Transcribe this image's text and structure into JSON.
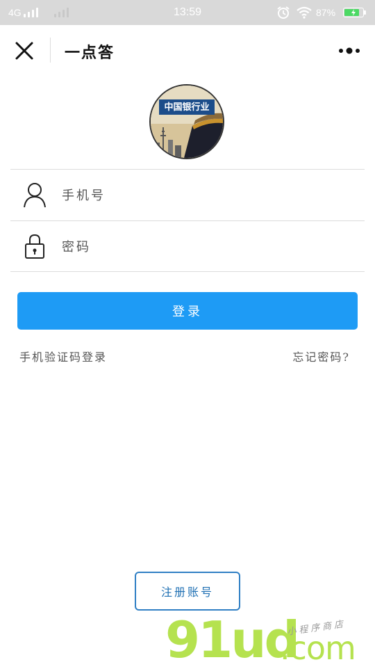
{
  "status_bar": {
    "network": "4G",
    "time": "13:59",
    "battery_percent": "87%",
    "battery_level": 0.87,
    "icons": [
      "signal-icon",
      "alarm-icon",
      "wifi-icon",
      "battery-charging-icon"
    ]
  },
  "nav": {
    "title": "一点答",
    "close_icon": "close-icon",
    "more_icon": "more-icon"
  },
  "avatar": {
    "caption": "中国银行业"
  },
  "form": {
    "phone_placeholder": "手机号",
    "password_placeholder": "密码",
    "phone_icon": "user-icon",
    "password_icon": "lock-icon"
  },
  "actions": {
    "login_label": "登录",
    "sms_login_label": "手机验证码登录",
    "forgot_label": "忘记密码?",
    "register_label": "注册账号"
  },
  "watermark": {
    "main": "91ud",
    "domain": ".com",
    "sub": "小程序商店"
  },
  "colors": {
    "primary": "#1e9bf5",
    "register_border": "#2f7fc4",
    "watermark": "#b5e24f"
  }
}
